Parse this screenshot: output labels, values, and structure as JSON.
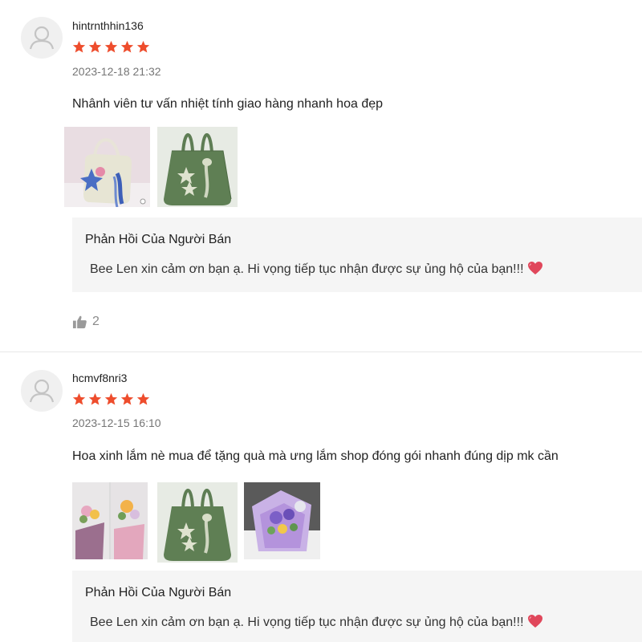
{
  "reviews": [
    {
      "username": "hintrnthhin136",
      "rating": 5,
      "date": "2023-12-18 21:32",
      "comment": "Nhânh viên tư vấn nhiệt tính giao hàng nhanh hoa đẹp",
      "photos": [
        "crochet-bag-pink-photo",
        "crochet-bag-green-photo"
      ],
      "reply": {
        "title": "Phản Hồi Của Người Bán",
        "text": "Bee Len xin cảm ơn bạn ạ. Hi vọng tiếp tục nhận được sự ủng hộ của bạn!!!"
      },
      "likes": "2"
    },
    {
      "username": "hcmvf8nri3",
      "rating": 5,
      "date": "2023-12-15 16:10",
      "comment": "Hoa xinh lắm nè mua để tặng quà mà ưng lắm shop đóng gói nhanh đúng dịp mk cần",
      "photos": [
        "flower-bouquet-photo",
        "crochet-bag-green-photo",
        "flower-bouquet-purple-photo"
      ],
      "reply": {
        "title": "Phản Hồi Của Người Bán",
        "text": "Bee Len xin cảm ơn bạn ạ. Hi vọng tiếp tục nhận được sự ủng hộ của bạn!!!"
      }
    }
  ],
  "colors": {
    "star": "#ee4d2d",
    "heart": "#e0475b",
    "reply_bg": "#f5f5f5",
    "meta_text": "#757575"
  },
  "icons": {
    "avatar": "user-placeholder-icon",
    "rating": "star-icon",
    "reply_emoji": "heart-icon",
    "like": "thumbs-up-icon"
  }
}
